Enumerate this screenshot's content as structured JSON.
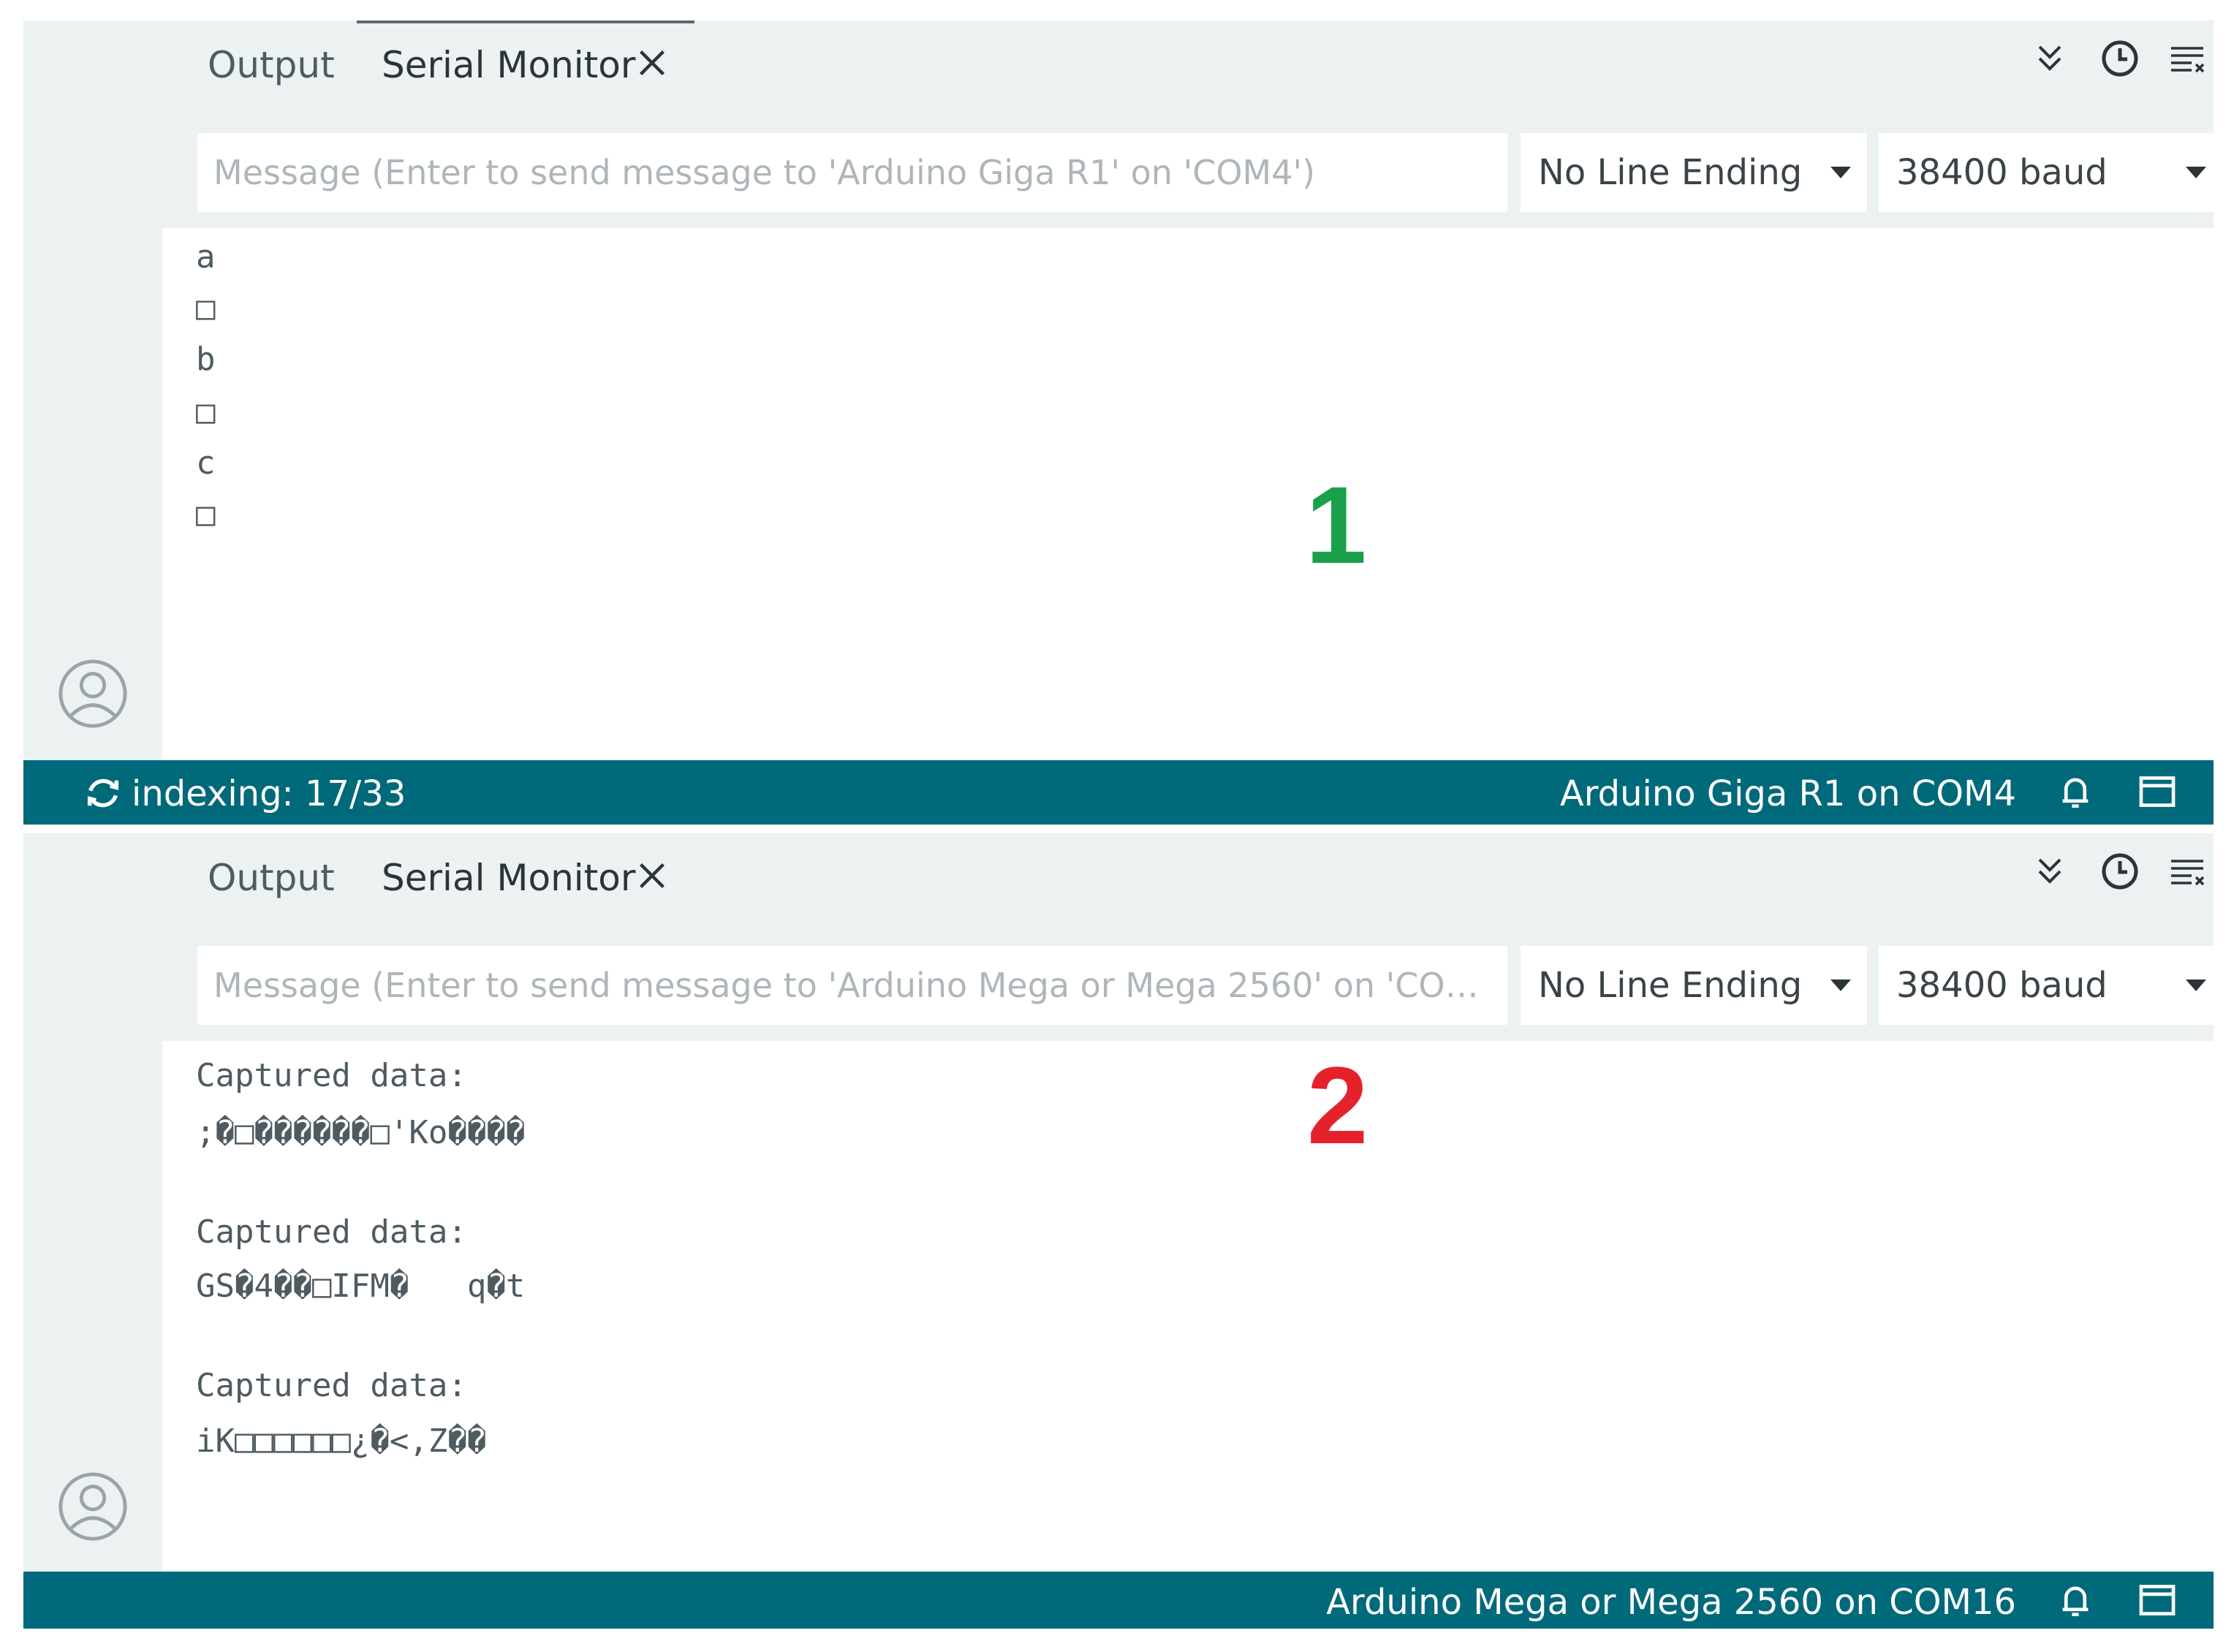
{
  "panel1": {
    "tabs": {
      "output": "Output",
      "serial_monitor": "Serial Monitor"
    },
    "message_placeholder": "Message (Enter to send message to 'Arduino Giga R1' on 'COM4')",
    "line_ending": "No Line Ending",
    "baud": "38400 baud",
    "console_lines": [
      "a",
      "□",
      "b",
      "□",
      "c",
      "□"
    ],
    "overlay_label": "1",
    "status_left": "indexing: 17/33",
    "status_right": "Arduino Giga R1 on COM4"
  },
  "panel2": {
    "tabs": {
      "output": "Output",
      "serial_monitor": "Serial Monitor"
    },
    "message_placeholder": "Message (Enter to send message to 'Arduino Mega or Mega 2560' on 'COM1...",
    "line_ending": "No Line Ending",
    "baud": "38400 baud",
    "console_lines": [
      "Captured data:",
      ";�□������□'Ko����",
      "",
      "Captured data:",
      "GS�4��□IFM�   q�t",
      "",
      "Captured data:",
      "iK□□□□□□¿�<,Z��"
    ],
    "overlay_label": "2",
    "status_right": "Arduino Mega or Mega 2560 on COM16"
  },
  "icons": [
    "scroll-down-icon",
    "timestamp-clock-icon",
    "clear-output-icon",
    "close-icon",
    "avatar-icon",
    "sync-icon",
    "bell-icon",
    "panel-layout-icon"
  ],
  "colors": {
    "status_bar": "#00697a",
    "label1": "#1aa04a",
    "label2": "#e5212b",
    "chrome_bg": "#ecf1f1"
  }
}
